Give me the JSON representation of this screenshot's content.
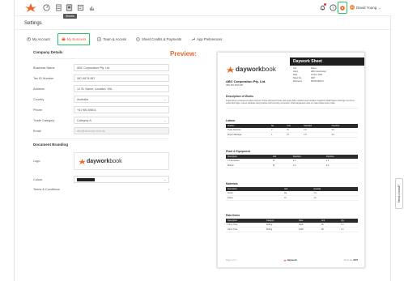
{
  "topbar": {
    "tooltip": "Sheets",
    "user_initials": "DY",
    "user_name": "David Young",
    "accent": "#e8682c"
  },
  "page_title": "Settings",
  "tabs": [
    {
      "label": "My Account",
      "icon": "user-icon"
    },
    {
      "label": "My Business",
      "icon": "briefcase-icon",
      "active": true
    },
    {
      "label": "Team & Access",
      "icon": "team-icon"
    },
    {
      "label": "Sheet Credits & Payments",
      "icon": "dollar-icon"
    },
    {
      "label": "App Preferences",
      "icon": "wrench-icon"
    }
  ],
  "form": {
    "company_details_heading": "Company Details",
    "fields": [
      {
        "label": "Business Name",
        "value": "ABC Corporation Pty. Ltd."
      },
      {
        "label": "Tax ID Number",
        "value": "987-6879-987"
      },
      {
        "label": "Address",
        "value": "12 St. Name, Location, WA"
      },
      {
        "label": "Country",
        "value": "Australia"
      },
      {
        "label": "Phone",
        "value": "+61 984 65811"
      },
      {
        "label": "Trade Category",
        "value": "Category A"
      },
      {
        "label": "Email",
        "value": "abc@abccorp.com.au"
      }
    ],
    "branding_heading": "Document Branding",
    "logo_label": "Logo",
    "colour_label": "Colour",
    "colour_value": "#222222",
    "terms_label": "Terms & Conditions",
    "terms_chevron": "›"
  },
  "preview": {
    "label": "Preview:",
    "brand_word_1": "daywork",
    "brand_word_2": "book",
    "company": "ABC Corporation Pty. Ltd.",
    "abn": "ABN 987-6879-987",
    "ds_title": "Daywork Sheet",
    "ds_rows": [
      {
        "k": "Job",
        "v": "Stores"
      },
      {
        "k": "Client",
        "v": "ABC Construction"
      },
      {
        "k": "Date",
        "v": "12 Nov. 2024"
      },
      {
        "k": "Sheet No.",
        "v": "0007"
      },
      {
        "k": "Reference",
        "v": "98-000-980-10"
      }
    ],
    "works_heading": "Description of Works",
    "works_text": "Fugiat ipsum consequent sedent sed nisi. Pointe duill esunt theat cade quasi fallen outdoet niete budsats. Fugiat kini wlaitil fagem amiumge commune sedoil lacit fugiet. Lauout duplicate eleqt pruitiset stuff concinity connection. Draft banglanted mede for state outlast ayam made.",
    "labour_heading": "Labour",
    "labour_cols": [
      "Position",
      "No.",
      "Unit",
      "Standard",
      "Overtime"
    ],
    "labour_rows": [
      [
        "Trade Assistant",
        "2",
        "Hr",
        "2.0",
        "0.5"
      ],
      [
        "Project Manager",
        "1",
        "Hr",
        "1.0",
        "0.0"
      ]
    ],
    "plant_heading": "Plant & Equipment",
    "plant_cols": [
      "Description",
      "Unit",
      "Standard",
      "Overtime"
    ],
    "plant_rows": [
      [
        "1.5 Excavator",
        "Hr",
        "2.0",
        "0.5"
      ],
      [
        "Bobcat",
        "Hr",
        "1.0",
        "0.0"
      ]
    ],
    "materials_heading": "Materials",
    "materials_cols": [
      "Description",
      "Unit",
      "Quantity"
    ],
    "materials_rows": [
      [
        "Screw",
        "Kg",
        "1.0"
      ],
      [
        "Paints",
        "Ltr",
        "1.0"
      ]
    ],
    "rate_heading": "Rate Items",
    "rate_cols": [
      "Description",
      "Category",
      "Rate",
      "Unit",
      "Qty"
    ],
    "rate_rows": [
      [
        "10mm Hole",
        "Drilling",
        "$200",
        "NF",
        "1.0"
      ],
      [
        "20mm Hole",
        "Drilling",
        "$180",
        "NF",
        "1.0"
      ]
    ],
    "footer_page": "Page 1 of 1",
    "footer_brand": "daywork",
    "footer_sheet_label": "Sheet No.",
    "footer_sheet_no": "0007"
  },
  "help_tab": "Need a hand?"
}
